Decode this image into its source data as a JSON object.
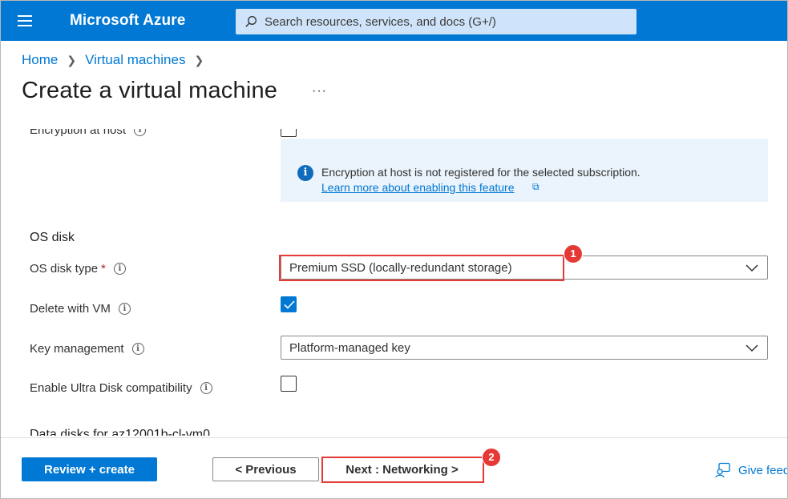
{
  "header": {
    "brand": "Microsoft Azure",
    "search_placeholder": "Search resources, services, and docs (G+/)"
  },
  "breadcrumb": [
    {
      "label": "Home"
    },
    {
      "label": "Virtual machines"
    }
  ],
  "page": {
    "title": "Create a virtual machine",
    "more_label": "···"
  },
  "encryption": {
    "label": "Encryption at host",
    "checked": false,
    "info_message": "Encryption at host is not registered for the selected subscription.",
    "info_link": "Learn more about enabling this feature"
  },
  "os_disk": {
    "section_title": "OS disk",
    "type_label": "OS disk type",
    "required_mark": "*",
    "type_value": "Premium SSD (locally-redundant storage)",
    "delete_label": "Delete with VM",
    "delete_checked": true,
    "key_label": "Key management",
    "key_value": "Platform-managed key",
    "ultra_label": "Enable Ultra Disk compatibility",
    "ultra_checked": false
  },
  "data_disks": {
    "section_title": "Data disks for az12001b-cl-vm0"
  },
  "callouts": [
    {
      "number": "1"
    },
    {
      "number": "2"
    }
  ],
  "footer": {
    "review_label": "Review + create",
    "previous_label": "< Previous",
    "next_label": "Next : Networking >",
    "feedback_label": "Give feedback"
  },
  "colors": {
    "azure_blue": "#0078d4",
    "callout_red": "#e53935",
    "info_bg": "#ebf3fc"
  }
}
